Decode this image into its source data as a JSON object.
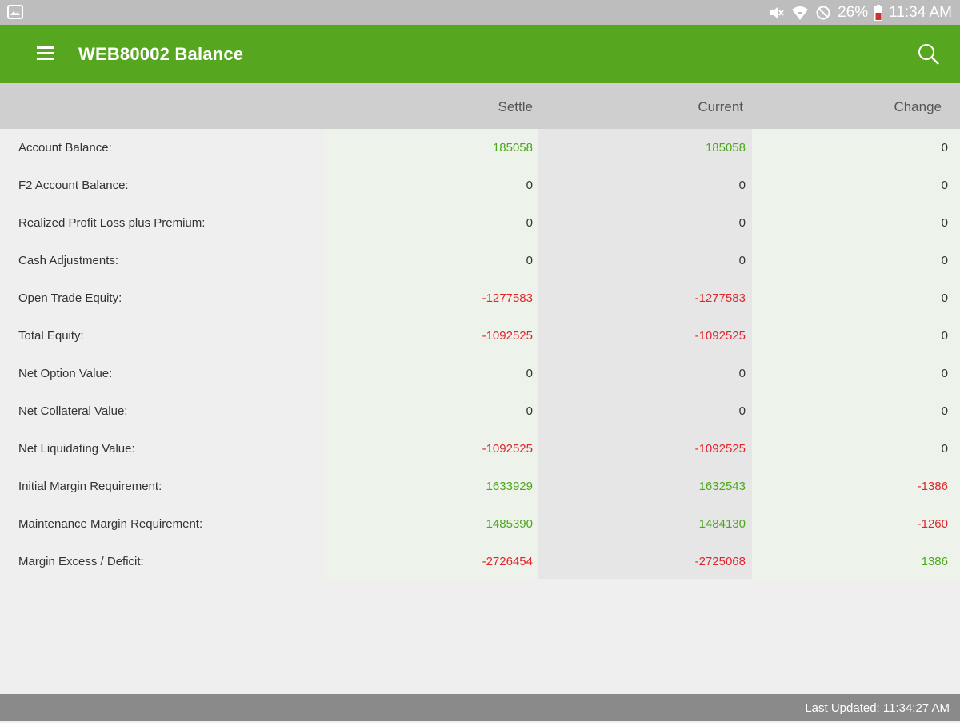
{
  "status_bar": {
    "battery": "26%",
    "time": "11:34 AM"
  },
  "app_bar": {
    "title": "WEB80002 Balance",
    "menu_icon": "hamburger-menu-icon",
    "search_icon": "search-icon"
  },
  "table": {
    "columns": [
      "Settle",
      "Current",
      "Change"
    ],
    "rows": [
      {
        "label": "Account Balance:",
        "settle": "185058",
        "current": "185058",
        "change": "0"
      },
      {
        "label": "F2 Account Balance:",
        "settle": "0",
        "current": "0",
        "change": "0"
      },
      {
        "label": "Realized Profit Loss plus Premium:",
        "settle": "0",
        "current": "0",
        "change": "0"
      },
      {
        "label": "Cash Adjustments:",
        "settle": "0",
        "current": "0",
        "change": "0"
      },
      {
        "label": "Open Trade Equity:",
        "settle": "-1277583",
        "current": "-1277583",
        "change": "0"
      },
      {
        "label": "Total Equity:",
        "settle": "-1092525",
        "current": "-1092525",
        "change": "0"
      },
      {
        "label": "Net Option Value:",
        "settle": "0",
        "current": "0",
        "change": "0"
      },
      {
        "label": "Net Collateral Value:",
        "settle": "0",
        "current": "0",
        "change": "0"
      },
      {
        "label": "Net Liquidating Value:",
        "settle": "-1092525",
        "current": "-1092525",
        "change": "0"
      },
      {
        "label": "Initial Margin Requirement:",
        "settle": "1633929",
        "current": "1632543",
        "change": "-1386"
      },
      {
        "label": "Maintenance Margin Requirement:",
        "settle": "1485390",
        "current": "1484130",
        "change": "-1260"
      },
      {
        "label": "Margin Excess / Deficit:",
        "settle": "-2726454",
        "current": "-2725068",
        "change": "1386"
      }
    ]
  },
  "footer": {
    "last_updated": "Last Updated: 11:34:27 AM"
  },
  "colors": {
    "app_bar": "#56a61f",
    "positive": "#4ea81d",
    "negative": "#e0262b"
  }
}
